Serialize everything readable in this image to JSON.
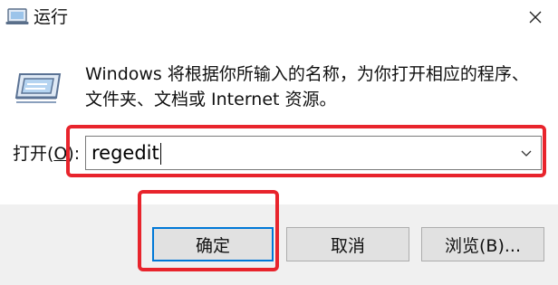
{
  "window": {
    "title": "运行",
    "close_icon": "close-icon",
    "app_icon": "run-app-icon"
  },
  "body": {
    "description": "Windows 将根据你所输入的名称，为你打开相应的程序、文件夹、文档或 Internet 资源。",
    "open_label": "打开(",
    "open_access_key": "O",
    "open_label_suffix": "):",
    "command_value": "regedit",
    "dropdown_icon": "chevron-down-icon"
  },
  "buttons": {
    "ok": "确定",
    "cancel": "取消",
    "browse": "浏览(B)..."
  },
  "colors": {
    "highlight": "#e8242c",
    "focus_border": "#0078d7",
    "footer_bg": "#f0f0f0"
  }
}
